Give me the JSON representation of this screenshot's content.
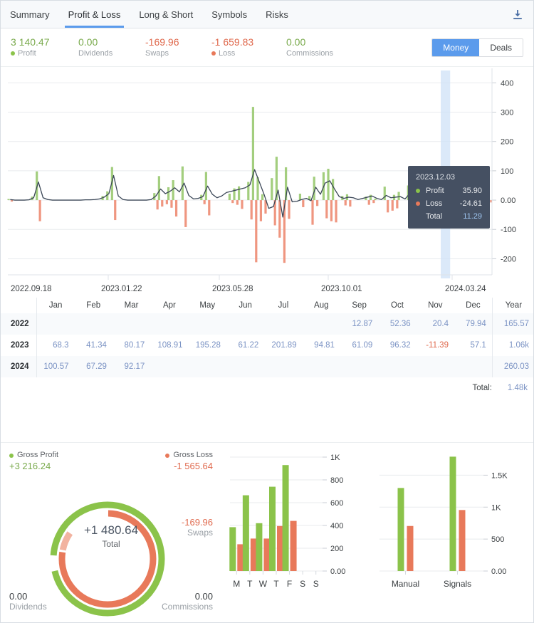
{
  "tabs": [
    {
      "label": "Summary",
      "active": false
    },
    {
      "label": "Profit & Loss",
      "active": true
    },
    {
      "label": "Long & Short",
      "active": false
    },
    {
      "label": "Symbols",
      "active": false
    },
    {
      "label": "Risks",
      "active": false
    }
  ],
  "download_icon": "download-icon",
  "colors": {
    "profit": "#8bc34a",
    "profit_bar": "#a3ce7e",
    "loss": "#e8795a",
    "loss_bar": "#ef9680",
    "swaps": "#f2b3a0",
    "accent": "#5b9bec",
    "line": "#3b4757",
    "link": "#7b93c4",
    "tooltip_bg": "#455062"
  },
  "stats": [
    {
      "value": "3 140.47",
      "label": "Profit",
      "value_color": "#7bab4e",
      "dot": "#8bc34a"
    },
    {
      "value": "0.00",
      "label": "Dividends",
      "value_color": "#7bab4e",
      "dot": null
    },
    {
      "value": "-169.96",
      "label": "Swaps",
      "value_color": "#e06a4e",
      "dot": null
    },
    {
      "value": "-1 659.83",
      "label": "Loss",
      "value_color": "#e06a4e",
      "dot": "#e8795a"
    },
    {
      "value": "0.00",
      "label": "Commissions",
      "value_color": "#7bab4e",
      "dot": null
    }
  ],
  "toggle": {
    "money": "Money",
    "deals": "Deals",
    "selected": "Money"
  },
  "tooltip": {
    "date": "2023.12.03",
    "profit_label": "Profit",
    "profit_value": "35.90",
    "loss_label": "Loss",
    "loss_value": "-24.61",
    "total_label": "Total",
    "total_value": "11.29"
  },
  "date_axis": [
    "2022.09.18",
    "2023.01.22",
    "2023.05.28",
    "2023.10.01",
    "2024.03.24"
  ],
  "table": {
    "year_header": "",
    "month_headers": [
      "Jan",
      "Feb",
      "Mar",
      "Apr",
      "May",
      "Jun",
      "Jul",
      "Aug",
      "Sep",
      "Oct",
      "Nov",
      "Dec"
    ],
    "total_header": "Year",
    "rows": [
      {
        "year": "2022",
        "values": [
          "",
          "",
          "",
          "",
          "",
          "",
          "",
          "",
          "12.87",
          "52.36",
          "20.4",
          "79.94"
        ],
        "total": "165.57"
      },
      {
        "year": "2023",
        "values": [
          "68.3",
          "41.34",
          "80.17",
          "108.91",
          "195.28",
          "61.22",
          "201.89",
          "94.81",
          "61.09",
          "96.32",
          "-11.39",
          "57.1"
        ],
        "total": "1.06k"
      },
      {
        "year": "2024",
        "values": [
          "100.57",
          "67.29",
          "92.17",
          "",
          "",
          "",
          "",
          "",
          "",
          "",
          "",
          ""
        ],
        "total": "260.03"
      }
    ],
    "total_label": "Total:",
    "total_value": "1.48k"
  },
  "donut": {
    "gross_profit_label": "Gross Profit",
    "gross_profit_value": "+3 216.24",
    "gross_loss_label": "Gross Loss",
    "gross_loss_value": "-1 565.64",
    "center_value": "+1 480.64",
    "center_label": "Total",
    "swaps_value": "-169.96",
    "swaps_label": "Swaps",
    "dividends_value": "0.00",
    "dividends_label": "Dividends",
    "commissions_value": "0.00",
    "commissions_label": "Commissions"
  },
  "chart_data": [
    {
      "type": "bar",
      "name": "profit-loss-timeline",
      "title": "",
      "xlabel": "",
      "ylabel": "",
      "ylim": [
        -250,
        430
      ],
      "yticks": [
        400,
        300,
        200,
        100,
        0,
        -100,
        -200
      ],
      "ytick_labels": [
        "400",
        "300",
        "200",
        "100",
        "0.00",
        "-100",
        "-200"
      ],
      "grid": true,
      "x_range": [
        "2022.09.18",
        "2024.03.24"
      ],
      "x_tick_labels": [
        "2022.09.18",
        "2023.01.22",
        "2023.05.28",
        "2023.10.01",
        "2024.03.24"
      ],
      "series": [
        {
          "name": "Profit",
          "color": "#a3ce7e",
          "values": [
            4,
            0,
            0,
            0,
            0,
            12,
            98,
            0,
            0,
            0,
            0,
            0,
            0,
            0,
            0,
            0,
            0,
            0,
            0,
            0,
            14,
            30,
            113,
            0,
            0,
            0,
            0,
            0,
            0,
            0,
            0,
            24,
            82,
            0,
            44,
            68,
            0,
            115,
            0,
            0,
            0,
            18,
            96,
            0,
            0,
            0,
            0,
            22,
            40,
            47,
            0,
            62,
            318,
            78,
            20,
            0,
            75,
            148,
            0,
            112,
            0,
            0,
            22,
            0,
            14,
            80,
            0,
            95,
            107,
            72,
            0,
            14,
            20,
            0,
            0,
            0,
            12,
            18,
            5,
            0,
            46,
            0,
            18,
            28,
            0,
            50,
            56,
            0,
            12,
            0,
            40,
            102,
            0,
            20,
            33,
            0,
            36,
            0,
            14,
            26,
            60,
            0,
            10
          ]
        },
        {
          "name": "Loss",
          "color": "#ef9680",
          "negative": true,
          "values": [
            -5,
            0,
            0,
            0,
            0,
            0,
            -72,
            0,
            0,
            0,
            0,
            0,
            0,
            0,
            0,
            0,
            0,
            0,
            0,
            0,
            0,
            0,
            -68,
            0,
            0,
            0,
            0,
            0,
            0,
            0,
            0,
            -32,
            -22,
            -14,
            -26,
            -56,
            0,
            -92,
            0,
            0,
            0,
            -14,
            -52,
            0,
            0,
            0,
            0,
            -10,
            -16,
            -30,
            0,
            -66,
            -212,
            -72,
            -46,
            0,
            -86,
            -128,
            -214,
            -64,
            0,
            0,
            -24,
            0,
            -84,
            -20,
            0,
            -62,
            -72,
            -76,
            0,
            -18,
            -22,
            0,
            0,
            0,
            -16,
            -10,
            0,
            0,
            -42,
            -36,
            -28,
            0,
            0,
            -22,
            -14,
            0,
            0,
            0,
            -36,
            -96,
            0,
            -14,
            -20,
            0,
            -28,
            0,
            0,
            -22,
            -18,
            0,
            -8
          ]
        },
        {
          "name": "Total",
          "color": "#3b4757",
          "type": "line",
          "values": [
            2,
            0,
            0,
            0,
            1,
            8,
            62,
            8,
            2,
            0,
            0,
            0,
            0,
            0,
            0,
            0,
            1,
            1,
            2,
            4,
            10,
            22,
            84,
            14,
            2,
            0,
            0,
            0,
            0,
            0,
            2,
            14,
            38,
            22,
            30,
            42,
            28,
            58,
            16,
            4,
            6,
            12,
            48,
            20,
            8,
            14,
            26,
            30,
            34,
            38,
            42,
            52,
            104,
            62,
            20,
            -28,
            -22,
            34,
            -58,
            44,
            -6,
            -4,
            2,
            6,
            -2,
            44,
            20,
            58,
            66,
            38,
            12,
            6,
            10,
            8,
            2,
            6,
            10,
            14,
            6,
            2,
            16,
            8,
            10,
            12,
            4,
            22,
            30,
            8,
            10,
            -2,
            6,
            34,
            8,
            -66,
            10,
            6,
            16,
            8,
            10,
            14,
            30,
            12,
            6
          ]
        }
      ],
      "highlight_index": 93,
      "highlight_color": "#cfe2f7"
    },
    {
      "type": "bar",
      "name": "weekday-profit-loss",
      "categories": [
        "M",
        "T",
        "W",
        "T",
        "F",
        "S",
        "S"
      ],
      "yticks": [
        0,
        200,
        400,
        600,
        800,
        1000
      ],
      "ytick_labels": [
        "0.00",
        "200",
        "400",
        "600",
        "800",
        "1K"
      ],
      "ylim": [
        0,
        1000
      ],
      "grid": true,
      "series": [
        {
          "name": "Profit",
          "color": "#8bc34a",
          "values": [
            385,
            665,
            420,
            740,
            930,
            0,
            0
          ]
        },
        {
          "name": "Loss",
          "color": "#e8795a",
          "values": [
            235,
            285,
            285,
            395,
            440,
            0,
            0
          ]
        }
      ]
    },
    {
      "type": "bar",
      "name": "source-profit-loss",
      "categories": [
        "Manual",
        "Signals"
      ],
      "yticks": [
        0,
        500,
        1000,
        1500
      ],
      "ytick_labels": [
        "0.00",
        "500",
        "1K",
        "1.5K"
      ],
      "ylim": [
        0,
        1850
      ],
      "grid": true,
      "series": [
        {
          "name": "Profit",
          "color": "#8bc34a",
          "values": [
            1300,
            1790
          ]
        },
        {
          "name": "Loss",
          "color": "#e8795a",
          "values": [
            705,
            955
          ]
        }
      ]
    },
    {
      "type": "pie",
      "name": "gross-profit-loss-donut",
      "labels": [
        "Gross Profit",
        "Gross Loss",
        "Swaps",
        "Dividends",
        "Commissions"
      ],
      "values": [
        3216.24,
        1565.64,
        169.96,
        0.0,
        0.0
      ],
      "colors": [
        "#8bc34a",
        "#e8795a",
        "#f2b3a0",
        "#8bc34a",
        "#8bc34a"
      ],
      "center_value": "+1 480.64",
      "center_label": "Total"
    }
  ]
}
